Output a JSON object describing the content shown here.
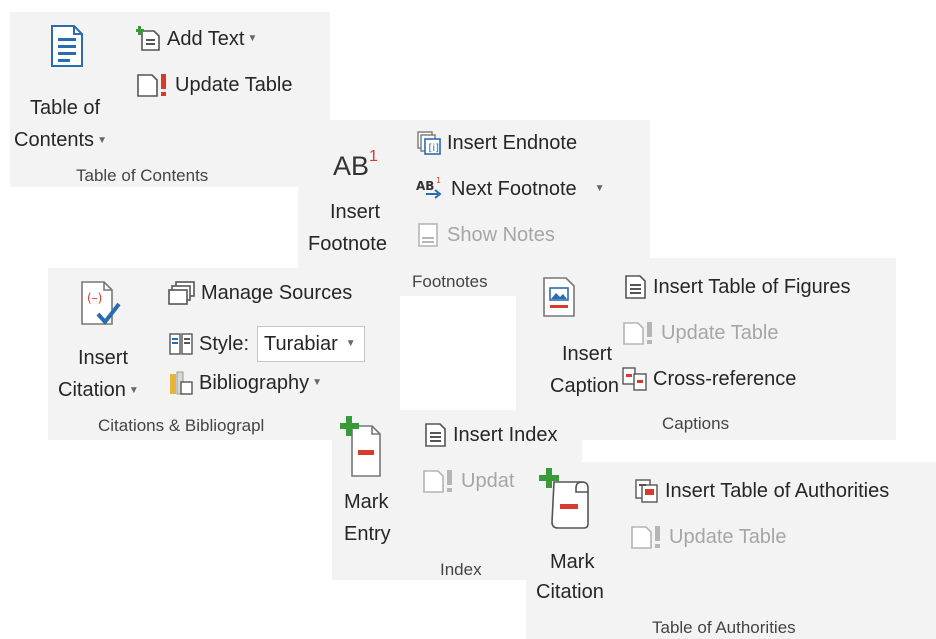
{
  "toc": {
    "big_line1": "Table of",
    "big_line2": "Contents",
    "add_text": "Add Text",
    "update_table": "Update Table",
    "group": "Table of Contents"
  },
  "footnotes": {
    "big_label": "AB",
    "big_sup": "1",
    "big_line1": "Insert",
    "big_line2": "Footnote",
    "insert_endnote": "Insert Endnote",
    "next_footnote": "Next Footnote",
    "show_notes": "Show Notes",
    "group": "Footnotes"
  },
  "citations": {
    "big_line1": "Insert",
    "big_line2": "Citation",
    "manage_sources": "Manage Sources",
    "style_label": "Style:",
    "style_value": "Turabiar",
    "bibliography": "Bibliography",
    "group": "Citations & Bibliograpl"
  },
  "captions": {
    "big_line1": "Insert",
    "big_line2": "Caption",
    "insert_tof": "Insert Table of Figures",
    "update_table": "Update Table",
    "cross_reference": "Cross-reference",
    "group": "Captions"
  },
  "index": {
    "big_line1": "Mark",
    "big_line2": "Entry",
    "insert_index": "Insert Index",
    "update": "Updat",
    "group": "Index"
  },
  "authorities": {
    "big_line1": "Mark",
    "big_line2": "Citation",
    "insert_toa": "Insert Table of Authorities",
    "update_table": "Update Table",
    "group": "Table of Authorities"
  },
  "colors": {
    "panel_bg": "#f3f3f3",
    "accent_blue": "#2b6cb0",
    "accent_red": "#d83b2b",
    "accent_green": "#3a9a3a",
    "disabled": "#a6a6a6"
  }
}
